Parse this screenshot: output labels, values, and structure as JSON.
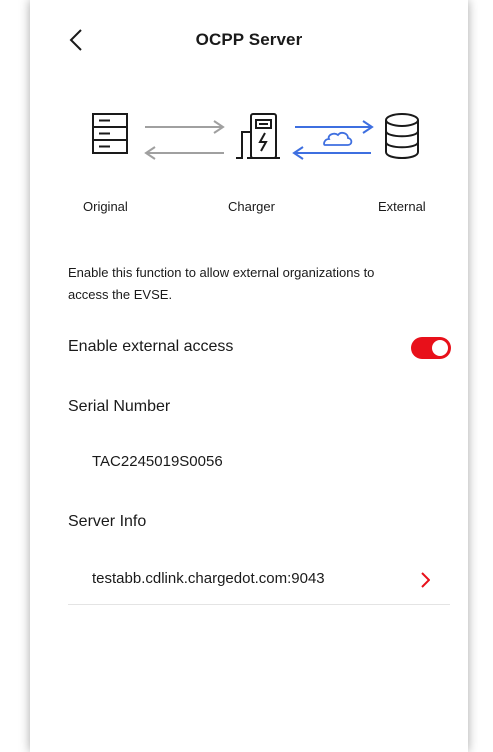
{
  "header": {
    "title": "OCPP Server",
    "back_icon": "chevron-left-icon"
  },
  "diagram": {
    "labels": {
      "original": "Original",
      "charger": "Charger",
      "external": "External"
    },
    "icons": [
      "server-rack-icon",
      "ev-charger-icon",
      "cloud-icon",
      "database-icon"
    ],
    "colors": {
      "gray_arrow": "#a0a0a0",
      "blue_arrow": "#3e6fe0"
    }
  },
  "description": "Enable this function to allow external organizations to access the EVSE.",
  "external_access": {
    "label": "Enable external access",
    "enabled": true,
    "accent": "#e8101a"
  },
  "serial": {
    "title": "Serial Number",
    "value": "TAC2245019S0056"
  },
  "server": {
    "title": "Server Info",
    "value": "testabb.cdlink.chargedot.com:9043",
    "chevron_color": "#e8101a"
  }
}
